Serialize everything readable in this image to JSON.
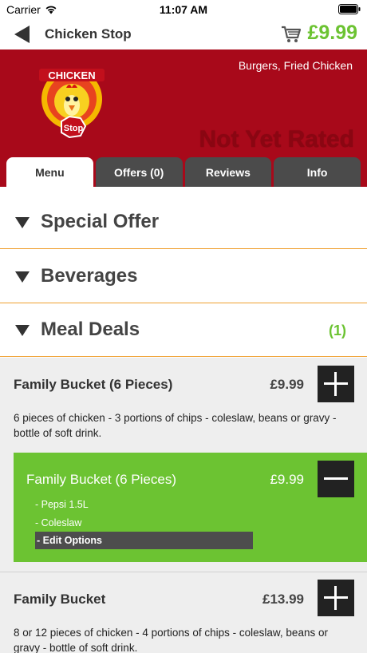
{
  "status": {
    "carrier": "Carrier",
    "time": "11:07 AM"
  },
  "nav": {
    "title": "Chicken Stop",
    "cart_total": "£9.99"
  },
  "banner": {
    "logo_text_top": "CHICKEN",
    "logo_text_bottom": "Stop",
    "cuisine": "Burgers, Fried Chicken",
    "rating": "Not Yet Rated"
  },
  "tabs": [
    {
      "label": "Menu",
      "active": true
    },
    {
      "label": "Offers (0)"
    },
    {
      "label": "Reviews"
    },
    {
      "label": "Info"
    }
  ],
  "sections": [
    {
      "title": "Special Offer",
      "count": ""
    },
    {
      "title": "Beverages",
      "count": ""
    },
    {
      "title": "Meal Deals",
      "count": "(1)"
    }
  ],
  "items": [
    {
      "name": "Family Bucket (6 Pieces)",
      "price": "£9.99",
      "description": "6 pieces of chicken - 3 portions of chips - coleslaw, beans or gravy - bottle of soft drink."
    },
    {
      "name": "Family Bucket",
      "price": "£13.99",
      "description": "8 or 12 pieces of chicken - 4 portions of chips - coleslaw, beans or gravy - bottle of soft drink."
    }
  ],
  "selected": {
    "name": "Family Bucket (6 Pieces)",
    "price": "£9.99",
    "options": [
      "- Pepsi 1.5L",
      "- Coleslaw"
    ],
    "edit_label": "- Edit Options"
  },
  "colors": {
    "brand_red": "#a8091a",
    "accent_green": "#6cc332",
    "dark": "#222222"
  }
}
